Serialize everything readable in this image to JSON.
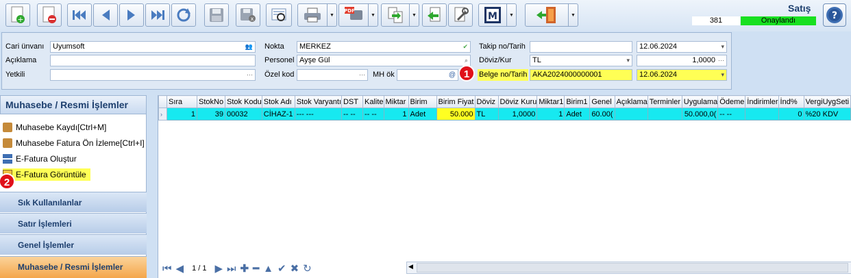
{
  "header": {
    "title": "Satış",
    "record_count": "381",
    "status": "Onaylandı"
  },
  "toolbar": {
    "buttons": [
      "new-icon",
      "delete-icon",
      "first-icon",
      "prev-icon",
      "next-icon",
      "last-icon",
      "refresh-icon",
      "save-icon",
      "cancel-save-icon",
      "preview-icon",
      "print-icon",
      "pdf-icon",
      "export-icon",
      "back-icon",
      "tools-icon",
      "m-icon",
      "exit-icon",
      "help-icon"
    ],
    "m_label": "M",
    "pdf_label": "PDF",
    "help_label": "?"
  },
  "form": {
    "cari_label": "Cari ünvanı",
    "cari_value": "Uyumsoft",
    "aciklama_label": "Açıklama",
    "aciklama_value": "",
    "yetkili_label": "Yetkili",
    "yetkili_value": "",
    "nokta_label": "Nokta",
    "nokta_value": "MERKEZ",
    "personel_label": "Personel",
    "personel_value": "Ayşe Gül",
    "ozelkod_label": "Özel kod",
    "ozelkod_value": "",
    "mhok_label": "MH ök",
    "mhok_value": "",
    "takip_label": "Takip no/Tarih",
    "takip_value": "",
    "takip_date": "12.06.2024",
    "doviz_label": "Döviz/Kur",
    "doviz_value": "TL",
    "kur_value": "1,0000",
    "belge_label": "Belge no/Tarih",
    "belge_value": "AKA2024000000001",
    "belge_date": "12.06.2024",
    "ellipsis": "···",
    "arrow": "▾",
    "at_sign": "@"
  },
  "badges": {
    "one": "1",
    "two": "2"
  },
  "sidebar": {
    "title": "Muhasebe / Resmi İşlemler",
    "items": [
      {
        "label": "Muhasebe Kaydı[Ctrl+M]"
      },
      {
        "label": "Muhasebe Fatura Ön İzleme[Ctrl+I]"
      },
      {
        "label": "E-Fatura Oluştur"
      },
      {
        "label": "E-Fatura Görüntüle"
      }
    ],
    "groups": [
      {
        "label": "Sık Kullanılanlar"
      },
      {
        "label": "Satır İşlemleri"
      },
      {
        "label": "Genel İşlemler"
      },
      {
        "label": "Muhasebe / Resmi İşlemler"
      }
    ]
  },
  "grid": {
    "columns": [
      "Sıra",
      "StokNo",
      "Stok Kodu",
      "Stok Adı",
      "Stok Varyantı",
      "DST",
      "Kalite",
      "Miktar",
      "Birim",
      "Birim Fiyat",
      "Döviz",
      "Döviz Kuru",
      "Miktar1",
      "Birim1",
      "Genel",
      "Açıklama",
      "Terminler",
      "Uygulama",
      "Ödeme",
      "İndirimler",
      "İnd%",
      "VergiUygSeti"
    ],
    "row": [
      "1",
      "39",
      "00032",
      "CİHAZ-1",
      "--- ---",
      "-- --",
      "-- --",
      "1",
      "Adet",
      "50.000",
      "TL",
      "1,0000",
      "1",
      "Adet",
      "60.00(",
      "",
      "",
      "50.000,0(",
      "-- --",
      "",
      "0",
      "%20 KDV"
    ],
    "page": "1 / 1"
  },
  "colors": {
    "status_green": "#18e020",
    "highlight_yellow": "#ffff55",
    "row_cyan": "#17e9f0",
    "badge_red": "#e0101a",
    "active_group": "#f4a64a"
  }
}
